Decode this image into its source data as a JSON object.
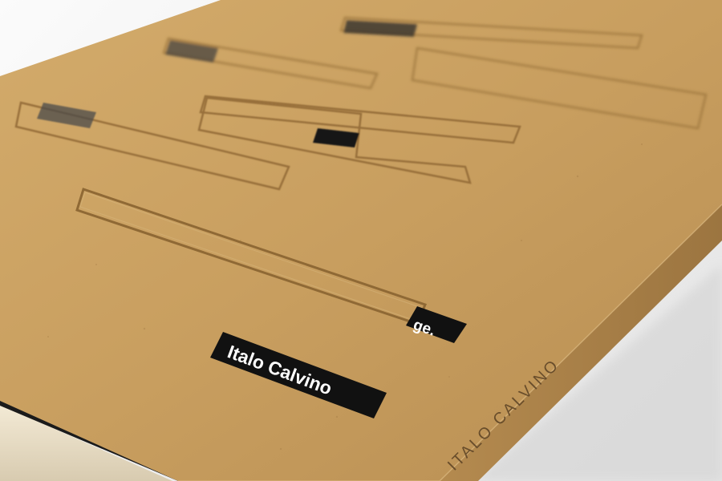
{
  "book": {
    "author_label": "Italo Calvino",
    "title_fragment": "ge.",
    "spine_text": "ITALO CALVINO"
  },
  "colors": {
    "kraft": "#c9a061",
    "kraft_dark": "#a97f43",
    "label_black": "#111111",
    "background": "#efefef"
  }
}
